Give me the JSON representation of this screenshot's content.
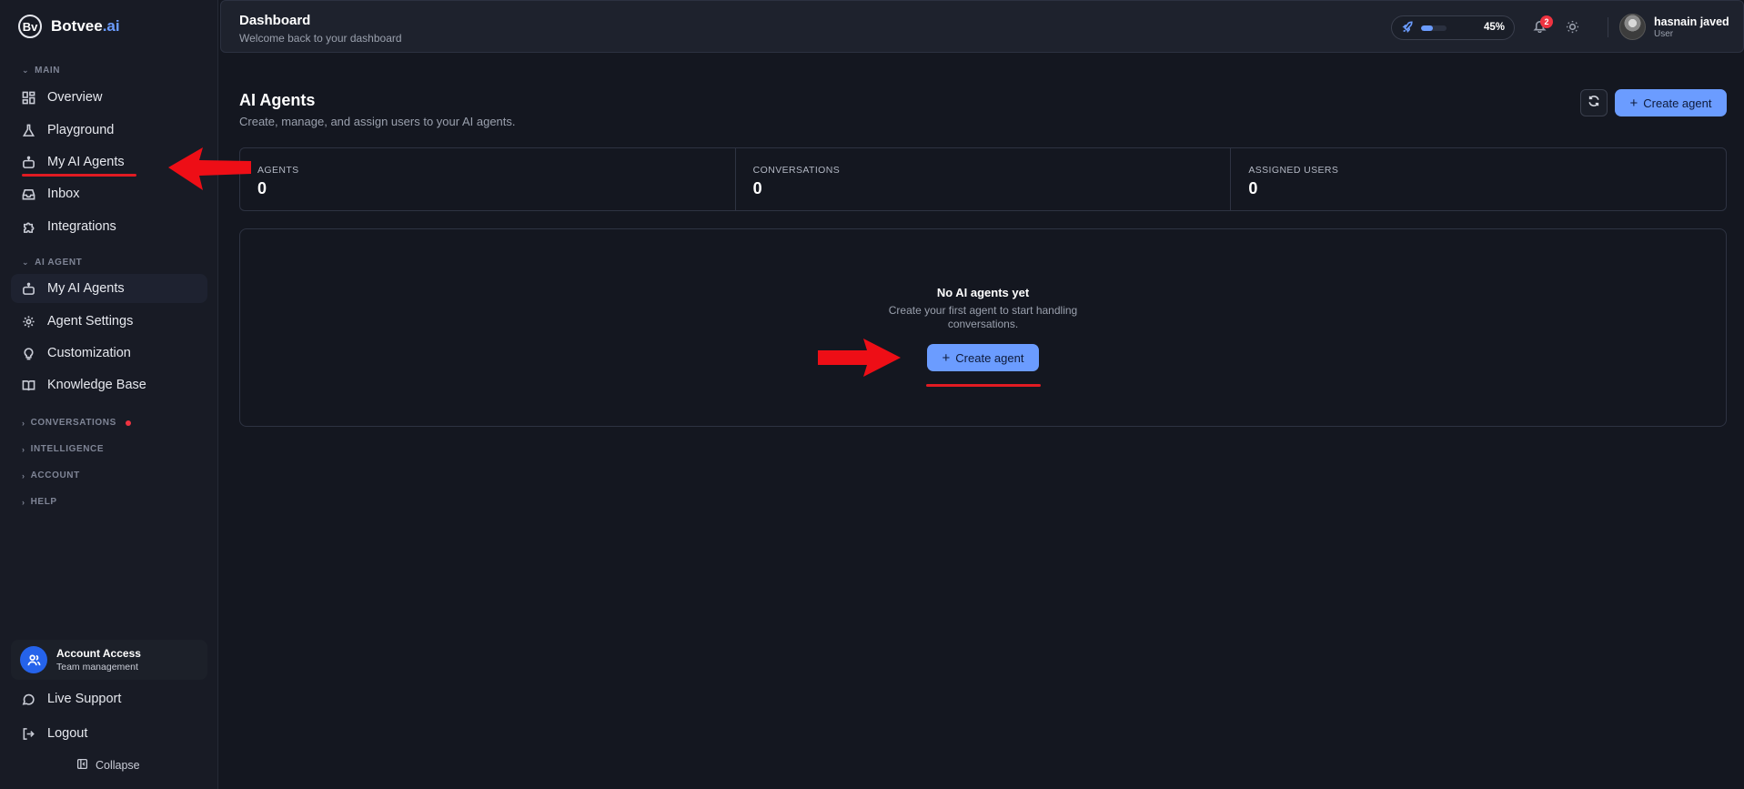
{
  "brand": {
    "logo_text": "Bv",
    "name": "Botvee",
    "suffix": ".ai"
  },
  "sidebar": {
    "sections": {
      "main": "MAIN",
      "ai_agent": "AI AGENT",
      "conversations": "CONVERSATIONS",
      "intelligence": "INTELLIGENCE",
      "account": "ACCOUNT",
      "help": "HELP"
    },
    "main_items": [
      {
        "label": "Overview",
        "icon": "grid-icon"
      },
      {
        "label": "Playground",
        "icon": "flask-icon"
      },
      {
        "label": "My AI Agents",
        "icon": "bot-icon"
      },
      {
        "label": "Inbox",
        "icon": "inbox-icon"
      },
      {
        "label": "Integrations",
        "icon": "puzzle-icon"
      }
    ],
    "agent_items": [
      {
        "label": "My AI Agents",
        "icon": "bot-icon"
      },
      {
        "label": "Agent Settings",
        "icon": "gear-icon"
      },
      {
        "label": "Customization",
        "icon": "lightbulb-icon"
      },
      {
        "label": "Knowledge Base",
        "icon": "book-icon"
      }
    ],
    "account_card": {
      "title": "Account Access",
      "subtitle": "Team management"
    },
    "live_support": "Live Support",
    "logout": "Logout",
    "collapse": "Collapse"
  },
  "header": {
    "title": "Dashboard",
    "subtitle": "Welcome back to your dashboard",
    "progress_percent": 45,
    "progress_label": "45%",
    "notification_count": "2",
    "user_name": "hasnain javed",
    "user_role": "User"
  },
  "main": {
    "title": "AI Agents",
    "subtitle": "Create, manage, and assign users to your AI agents.",
    "create_button": "Create agent",
    "stats": [
      {
        "label": "AGENTS",
        "value": "0"
      },
      {
        "label": "CONVERSATIONS",
        "value": "0"
      },
      {
        "label": "ASSIGNED USERS",
        "value": "0"
      }
    ],
    "empty": {
      "title": "No AI agents yet",
      "subtitle": "Create your first agent to start handling conversations.",
      "button": "Create agent"
    }
  },
  "colors": {
    "accent": "#6b9cff",
    "annotation_red": "#e11b22",
    "background": "#141720",
    "sidebar": "#181b25"
  }
}
